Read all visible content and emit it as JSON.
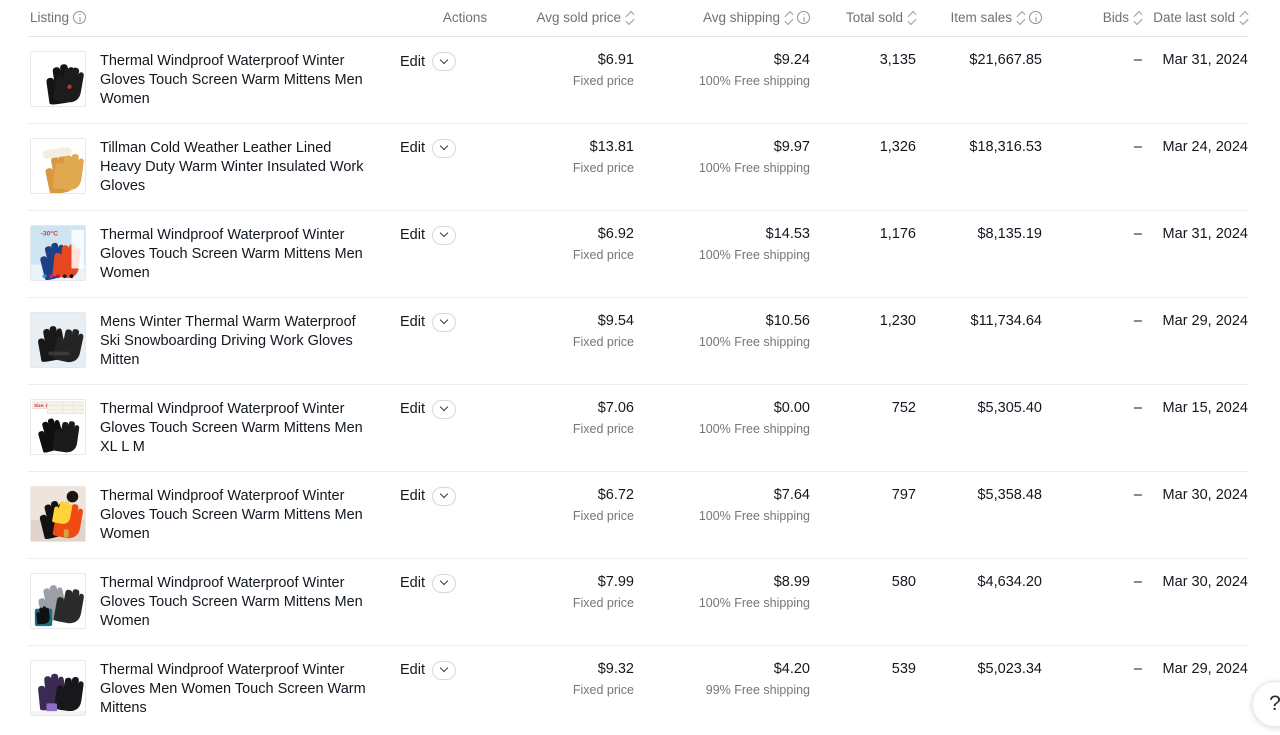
{
  "table": {
    "columns": [
      {
        "key": "listing",
        "label": "Listing",
        "align": "l",
        "info": true,
        "sortable": false
      },
      {
        "key": "actions",
        "label": "Actions",
        "align": "c",
        "info": false,
        "sortable": false
      },
      {
        "key": "avg_sold",
        "label": "Avg sold price",
        "align": "r",
        "info": false,
        "sortable": true
      },
      {
        "key": "avg_ship",
        "label": "Avg shipping",
        "align": "r",
        "info": true,
        "sortable": true
      },
      {
        "key": "total_sold",
        "label": "Total sold",
        "align": "r",
        "info": false,
        "sortable": true
      },
      {
        "key": "item_sales",
        "label": "Item sales",
        "align": "r",
        "info": true,
        "sortable": true
      },
      {
        "key": "bids",
        "label": "Bids",
        "align": "r",
        "info": false,
        "sortable": true
      },
      {
        "key": "date_sold",
        "label": "Date last sold",
        "align": "r",
        "info": false,
        "sortable": true
      }
    ],
    "edit_label": "Edit",
    "rows": [
      {
        "title": "Thermal Windproof Waterproof Winter Gloves Touch Screen Warm Mittens Men Women",
        "thumb": "black-touchscreen-glove",
        "avg_sold_price": "$6.91",
        "avg_sold_price_sub": "Fixed price",
        "avg_shipping": "$9.24",
        "avg_shipping_sub": "100% Free shipping",
        "total_sold": "3,135",
        "item_sales": "$21,667.85",
        "bids": "–",
        "date_last_sold": "Mar 31, 2024"
      },
      {
        "title": "Tillman Cold Weather Leather Lined Heavy Duty Warm Winter Insulated Work Gloves",
        "thumb": "tan-leather-work-glove",
        "avg_sold_price": "$13.81",
        "avg_sold_price_sub": "Fixed price",
        "avg_shipping": "$9.97",
        "avg_shipping_sub": "100% Free shipping",
        "total_sold": "1,326",
        "item_sales": "$18,316.53",
        "bids": "–",
        "date_last_sold": "Mar 24, 2024"
      },
      {
        "title": "Thermal Windproof Waterproof Winter Gloves Touch Screen Warm Mittens Men Women",
        "thumb": "blue-thermal-glove-snow",
        "avg_sold_price": "$6.92",
        "avg_sold_price_sub": "Fixed price",
        "avg_shipping": "$14.53",
        "avg_shipping_sub": "100% Free shipping",
        "total_sold": "1,176",
        "item_sales": "$8,135.19",
        "bids": "–",
        "date_last_sold": "Mar 31, 2024"
      },
      {
        "title": "Mens Winter Thermal Warm Waterproof Ski Snowboarding Driving Work Gloves Mitten",
        "thumb": "black-ski-gloves-pair",
        "avg_sold_price": "$9.54",
        "avg_sold_price_sub": "Fixed price",
        "avg_shipping": "$10.56",
        "avg_shipping_sub": "100% Free shipping",
        "total_sold": "1,230",
        "item_sales": "$11,734.64",
        "bids": "–",
        "date_last_sold": "Mar 29, 2024"
      },
      {
        "title": "Thermal Windproof Waterproof Winter Gloves Touch Screen Warm Mittens Men XL L M",
        "thumb": "black-gloves-size-chart",
        "avg_sold_price": "$7.06",
        "avg_sold_price_sub": "Fixed price",
        "avg_shipping": "$0.00",
        "avg_shipping_sub": "100% Free shipping",
        "total_sold": "752",
        "item_sales": "$5,305.40",
        "bids": "–",
        "date_last_sold": "Mar 15, 2024"
      },
      {
        "title": "Thermal Windproof Waterproof Winter Gloves Touch Screen Warm Mittens Men Women",
        "thumb": "heat-map-glove",
        "avg_sold_price": "$6.72",
        "avg_sold_price_sub": "Fixed price",
        "avg_shipping": "$7.64",
        "avg_shipping_sub": "100% Free shipping",
        "total_sold": "797",
        "item_sales": "$5,358.48",
        "bids": "–",
        "date_last_sold": "Mar 30, 2024"
      },
      {
        "title": "Thermal Windproof Waterproof Winter Gloves Touch Screen Warm Mittens Men Women",
        "thumb": "grey-black-gloves-phone",
        "avg_sold_price": "$7.99",
        "avg_sold_price_sub": "Fixed price",
        "avg_shipping": "$8.99",
        "avg_shipping_sub": "100% Free shipping",
        "total_sold": "580",
        "item_sales": "$4,634.20",
        "bids": "–",
        "date_last_sold": "Mar 30, 2024"
      },
      {
        "title": "Thermal Windproof Waterproof Winter Gloves Men Women Touch Screen Warm Mittens",
        "thumb": "purple-black-mittens",
        "avg_sold_price": "$9.32",
        "avg_sold_price_sub": "Fixed price",
        "avg_shipping": "$4.20",
        "avg_shipping_sub": "99% Free shipping",
        "total_sold": "539",
        "item_sales": "$5,023.34",
        "bids": "–",
        "date_last_sold": "Mar 29, 2024"
      }
    ]
  },
  "help": {
    "label": "?"
  },
  "colors": {
    "text_primary": "#111820",
    "text_secondary": "#767676",
    "header_text": "#707070",
    "row_divider": "#eeeeee",
    "background": "#ffffff"
  }
}
